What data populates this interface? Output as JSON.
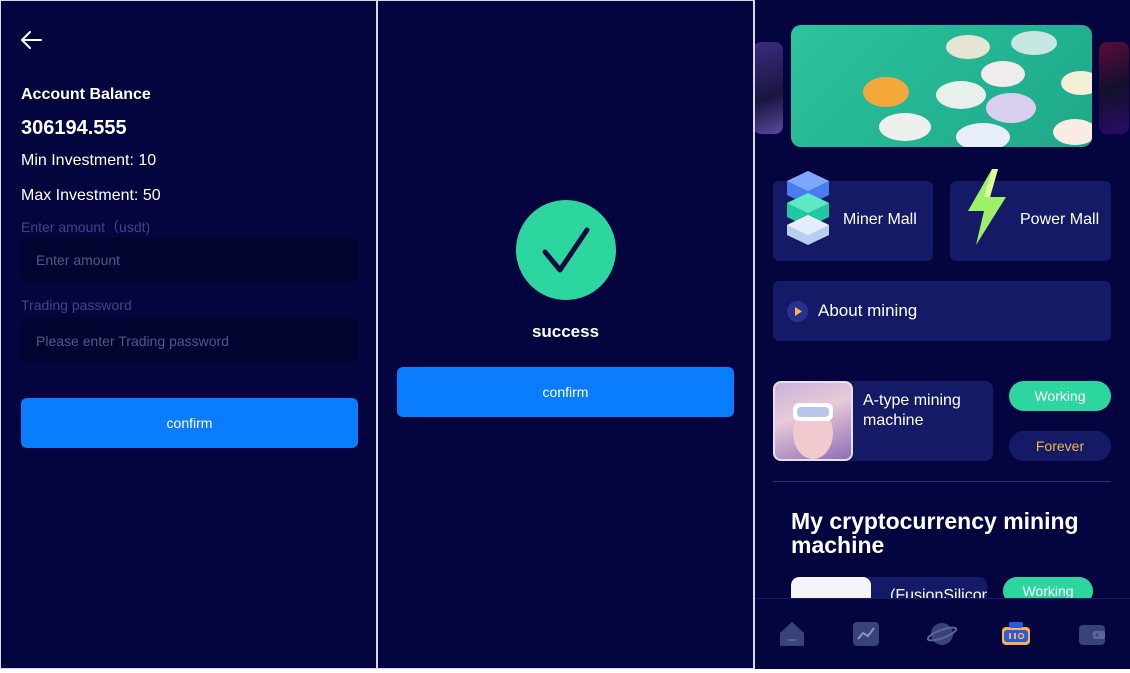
{
  "panel1": {
    "account_balance_label": "Account Balance",
    "account_balance_value": "306194.555",
    "min_investment": "Min Investment: 10",
    "max_investment": "Max Investment: 50",
    "amount_label": "Enter amount（usdt)",
    "amount_placeholder": "Enter amount",
    "amount_value": "",
    "password_label": "Trading password",
    "password_placeholder": "Please enter Trading password",
    "password_value": "",
    "confirm_label": "confirm"
  },
  "panel2": {
    "status_text": "success",
    "confirm_label": "confirm"
  },
  "panel3": {
    "miner_mall_label": "Miner Mall",
    "power_mall_label": "Power Mall",
    "about_mining_label": "About mining",
    "machine_name": "A-type mining machine",
    "working_label": "Working",
    "forever_label": "Forever",
    "my_machines_title": "My cryptocurrency mining machine",
    "card2_name": "(FusionSilicon)",
    "card2_status": "Working"
  },
  "colors": {
    "background": "#04053f",
    "card": "#141a66",
    "accent_blue": "#0a7cff",
    "success_green": "#2ed69f",
    "forever_orange": "#f6b44a"
  },
  "icons": [
    "back-arrow-icon",
    "checkmark-icon",
    "play-icon",
    "home-icon",
    "chart-icon",
    "planet-icon",
    "miner-icon",
    "wallet-icon"
  ]
}
